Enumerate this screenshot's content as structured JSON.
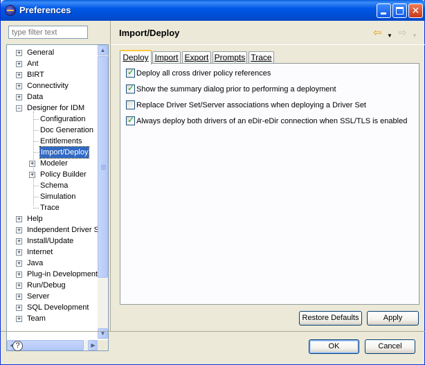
{
  "window": {
    "title": "Preferences"
  },
  "titlebar_buttons": {
    "minimize": "minimize-icon",
    "maximize": "maximize-icon",
    "close": "close-icon"
  },
  "filter": {
    "placeholder": "type filter text",
    "value": "type filter text"
  },
  "tree": {
    "items": [
      {
        "label": "General",
        "expander": "+"
      },
      {
        "label": "Ant",
        "expander": "+"
      },
      {
        "label": "BIRT",
        "expander": "+"
      },
      {
        "label": "Connectivity",
        "expander": "+"
      },
      {
        "label": "Data",
        "expander": "+"
      },
      {
        "label": "Designer for IDM",
        "expander": "−"
      },
      {
        "label": "Configuration"
      },
      {
        "label": "Doc Generation"
      },
      {
        "label": "Entitlements"
      },
      {
        "label": "Import/Deploy",
        "selected": true
      },
      {
        "label": "Modeler",
        "expander": "+"
      },
      {
        "label": "Policy Builder",
        "expander": "+"
      },
      {
        "label": "Schema"
      },
      {
        "label": "Simulation"
      },
      {
        "label": "Trace"
      },
      {
        "label": "Help",
        "expander": "+"
      },
      {
        "label": "Independent Driver S",
        "expander": "+"
      },
      {
        "label": "Install/Update",
        "expander": "+"
      },
      {
        "label": "Internet",
        "expander": "+"
      },
      {
        "label": "Java",
        "expander": "+"
      },
      {
        "label": "Plug-in Development",
        "expander": "+"
      },
      {
        "label": "Run/Debug",
        "expander": "+"
      },
      {
        "label": "Server",
        "expander": "+"
      },
      {
        "label": "SQL Development",
        "expander": "+"
      },
      {
        "label": "Team",
        "expander": "+"
      }
    ]
  },
  "page": {
    "title": "Import/Deploy"
  },
  "nav": {
    "back_icon": "back-arrow-icon",
    "forward_icon": "forward-arrow-icon"
  },
  "tabs": [
    {
      "label": "Deploy",
      "active": true
    },
    {
      "label": "Import"
    },
    {
      "label": "Export"
    },
    {
      "label": "Prompts"
    },
    {
      "label": "Trace"
    }
  ],
  "options": [
    {
      "label": "Deploy all cross driver policy references",
      "checked": true
    },
    {
      "label": "Show the summary dialog prior to performing a deployment",
      "checked": true
    },
    {
      "label": "Replace Driver Set/Server associations when deploying a Driver Set",
      "checked": false
    },
    {
      "label": "Always deploy both drivers of an eDir-eDir connection when SSL/TLS is enabled",
      "checked": true
    }
  ],
  "buttons": {
    "restore_defaults": "Restore Defaults",
    "apply": "Apply",
    "ok": "OK",
    "cancel": "Cancel",
    "help": "?"
  },
  "colors": {
    "titlebar": "#0054e3",
    "selection": "#316ac5",
    "tab_accent": "#ffc83c"
  }
}
